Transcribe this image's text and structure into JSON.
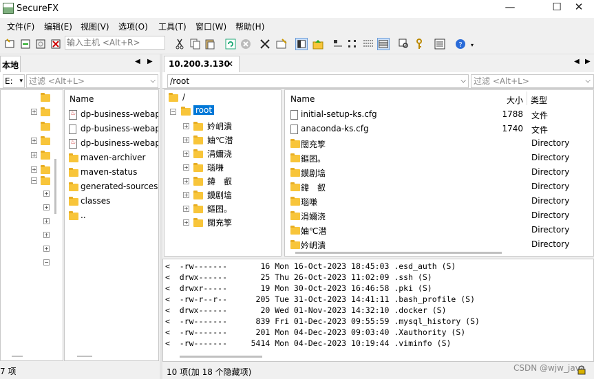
{
  "window": {
    "title": "SecureFX",
    "minimize": "—",
    "maximize": "☐",
    "close": "✕"
  },
  "menu": [
    "文件(F)",
    "编辑(E)",
    "视图(V)",
    "选项(O)",
    "工具(T)",
    "窗口(W)",
    "帮助(H)"
  ],
  "toolbar": {
    "host_placeholder": "输入主机 <Alt+R>"
  },
  "local": {
    "tab_label": "本地",
    "drive": "E:",
    "filter_placeholder": "过滤 <Alt+L>",
    "col_name": "Name",
    "files": [
      {
        "name": "dp-business-webap",
        "icon": "java"
      },
      {
        "name": "dp-business-webap",
        "icon": "file"
      },
      {
        "name": "dp-business-webap",
        "icon": "java"
      },
      {
        "name": "maven-archiver",
        "icon": "folder"
      },
      {
        "name": "maven-status",
        "icon": "folder"
      },
      {
        "name": "generated-sources",
        "icon": "folder"
      },
      {
        "name": "classes",
        "icon": "folder"
      },
      {
        "name": "..",
        "icon": "folder"
      }
    ],
    "status": "7 项"
  },
  "remote": {
    "tab_label": "10.200.3.130",
    "tab_close": "✕",
    "path": "/root",
    "filter_placeholder": "过滤 <Alt+L>",
    "tree_root": "/",
    "tree_selected": "root",
    "tree_children": [
      "妗岄潰",
      "妯℃澘",
      "涓嬭浇",
      "瑙嗛",
      "鍏　叡",
      "鏌剧墖",
      "鏂囨。",
      "闊充箰"
    ],
    "cols": {
      "name": "Name",
      "size": "大小",
      "type": "类型"
    },
    "files": [
      {
        "name": "initial-setup-ks.cfg",
        "size": "1788",
        "type": "文件",
        "icon": "file"
      },
      {
        "name": "anaconda-ks.cfg",
        "size": "1740",
        "type": "文件",
        "icon": "file"
      },
      {
        "name": "闊充箰",
        "size": "",
        "type": "Directory",
        "icon": "folder"
      },
      {
        "name": "鏂囨。",
        "size": "",
        "type": "Directory",
        "icon": "folder"
      },
      {
        "name": "鏌剧墖",
        "size": "",
        "type": "Directory",
        "icon": "folder"
      },
      {
        "name": "鍏　叡",
        "size": "",
        "type": "Directory",
        "icon": "folder"
      },
      {
        "name": "瑙嗛",
        "size": "",
        "type": "Directory",
        "icon": "folder"
      },
      {
        "name": "涓嬭浇",
        "size": "",
        "type": "Directory",
        "icon": "folder"
      },
      {
        "name": "妯℃澘",
        "size": "",
        "type": "Directory",
        "icon": "folder"
      },
      {
        "name": "妗岄潰",
        "size": "",
        "type": "Directory",
        "icon": "folder"
      }
    ],
    "log": [
      "<  -rw-------       16 Mon 16-Oct-2023 18:45:03 .esd_auth (S)",
      "<  drwx------       25 Thu 26-Oct-2023 11:02:09 .ssh (S)",
      "<  drwxr-----       19 Mon 30-Oct-2023 16:46:58 .pki (S)",
      "<  -rw-r--r--      205 Tue 31-Oct-2023 14:41:11 .bash_profile (S)",
      "<  drwx------       20 Wed 01-Nov-2023 14:32:10 .docker (S)",
      "<  -rw-------      839 Fri 01-Dec-2023 09:55:59 .mysql_history (S)",
      "<  -rw-------      201 Mon 04-Dec-2023 09:03:40 .Xauthority (S)",
      "<  -rw-------     5414 Mon 04-Dec-2023 10:19:44 .viminfo (S)"
    ],
    "status": "10 项(加 18 个隐藏项)",
    "watermark": "CSDN @wjw_java"
  }
}
